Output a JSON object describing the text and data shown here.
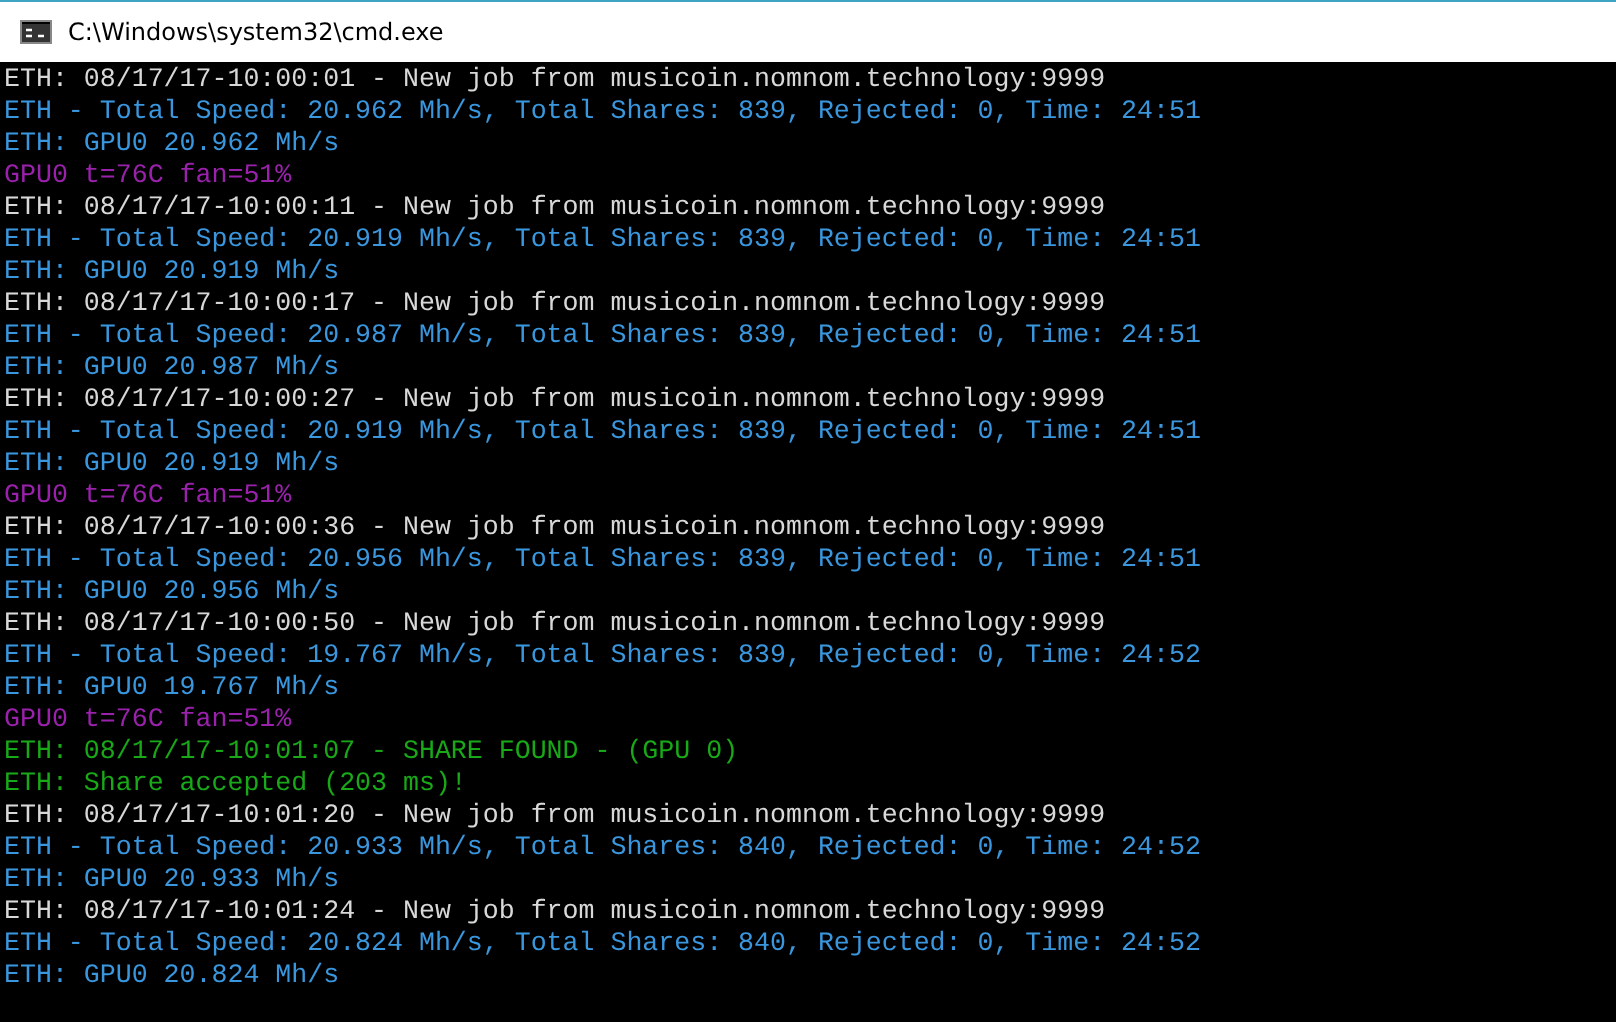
{
  "window": {
    "title": "C:\\Windows\\system32\\cmd.exe"
  },
  "console_lines": [
    {
      "kind": "job",
      "text": "ETH: 08/17/17-10:00:01 - New job from musicoin.nomnom.technology:9999"
    },
    {
      "kind": "stat",
      "text": "ETH - Total Speed: 20.962 Mh/s, Total Shares: 839, Rejected: 0, Time: 24:51"
    },
    {
      "kind": "stat",
      "text": "ETH: GPU0 20.962 Mh/s"
    },
    {
      "kind": "temp",
      "text": "GPU0 t=76C fan=51%"
    },
    {
      "kind": "job",
      "text": "ETH: 08/17/17-10:00:11 - New job from musicoin.nomnom.technology:9999"
    },
    {
      "kind": "stat",
      "text": "ETH - Total Speed: 20.919 Mh/s, Total Shares: 839, Rejected: 0, Time: 24:51"
    },
    {
      "kind": "stat",
      "text": "ETH: GPU0 20.919 Mh/s"
    },
    {
      "kind": "job",
      "text": "ETH: 08/17/17-10:00:17 - New job from musicoin.nomnom.technology:9999"
    },
    {
      "kind": "stat",
      "text": "ETH - Total Speed: 20.987 Mh/s, Total Shares: 839, Rejected: 0, Time: 24:51"
    },
    {
      "kind": "stat",
      "text": "ETH: GPU0 20.987 Mh/s"
    },
    {
      "kind": "job",
      "text": "ETH: 08/17/17-10:00:27 - New job from musicoin.nomnom.technology:9999"
    },
    {
      "kind": "stat",
      "text": "ETH - Total Speed: 20.919 Mh/s, Total Shares: 839, Rejected: 0, Time: 24:51"
    },
    {
      "kind": "stat",
      "text": "ETH: GPU0 20.919 Mh/s"
    },
    {
      "kind": "temp",
      "text": "GPU0 t=76C fan=51%"
    },
    {
      "kind": "job",
      "text": "ETH: 08/17/17-10:00:36 - New job from musicoin.nomnom.technology:9999"
    },
    {
      "kind": "stat",
      "text": "ETH - Total Speed: 20.956 Mh/s, Total Shares: 839, Rejected: 0, Time: 24:51"
    },
    {
      "kind": "stat",
      "text": "ETH: GPU0 20.956 Mh/s"
    },
    {
      "kind": "job",
      "text": "ETH: 08/17/17-10:00:50 - New job from musicoin.nomnom.technology:9999"
    },
    {
      "kind": "stat",
      "text": "ETH - Total Speed: 19.767 Mh/s, Total Shares: 839, Rejected: 0, Time: 24:52"
    },
    {
      "kind": "stat",
      "text": "ETH: GPU0 19.767 Mh/s"
    },
    {
      "kind": "temp",
      "text": "GPU0 t=76C fan=51%"
    },
    {
      "kind": "share",
      "text": "ETH: 08/17/17-10:01:07 - SHARE FOUND - (GPU 0)"
    },
    {
      "kind": "share",
      "text": "ETH: Share accepted (203 ms)!"
    },
    {
      "kind": "job",
      "text": "ETH: 08/17/17-10:01:20 - New job from musicoin.nomnom.technology:9999"
    },
    {
      "kind": "stat",
      "text": "ETH - Total Speed: 20.933 Mh/s, Total Shares: 840, Rejected: 0, Time: 24:52"
    },
    {
      "kind": "stat",
      "text": "ETH: GPU0 20.933 Mh/s"
    },
    {
      "kind": "job",
      "text": "ETH: 08/17/17-10:01:24 - New job from musicoin.nomnom.technology:9999"
    },
    {
      "kind": "stat",
      "text": "ETH - Total Speed: 20.824 Mh/s, Total Shares: 840, Rejected: 0, Time: 24:52"
    },
    {
      "kind": "stat",
      "text": "ETH: GPU0 20.824 Mh/s"
    }
  ]
}
